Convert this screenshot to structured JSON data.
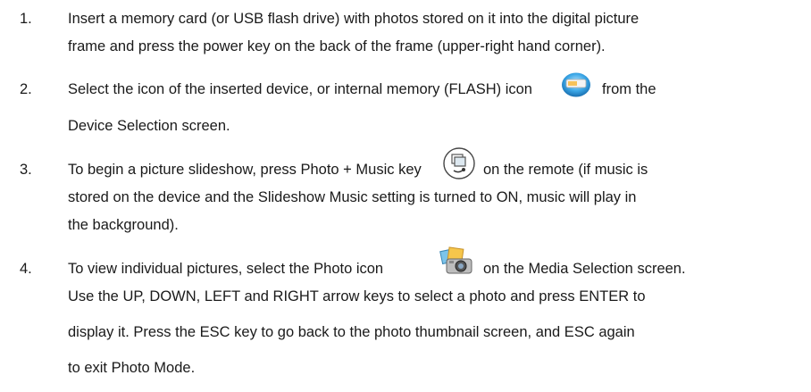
{
  "steps": [
    {
      "number": "1.",
      "lines": [
        "Insert a memory card (or USB flash drive) with photos stored on it into the digital picture",
        "frame and press the power key on the back of the frame (upper-right hand corner)."
      ]
    },
    {
      "number": "2.",
      "line1_before_icon": "Select the icon of the inserted device, or internal memory (FLASH) icon",
      "line1_after_icon": "from the",
      "line2": "Device Selection screen.",
      "icon": "flash-memory-icon"
    },
    {
      "number": "3.",
      "line1_before_icon": "To begin a picture slideshow, press Photo + Music key",
      "line1_after_icon": "on the remote (if music is",
      "line2": "stored on the device and the Slideshow Music setting is turned to ON, music will play in",
      "line3": "the background).",
      "icon": "photo-music-key-icon"
    },
    {
      "number": "4.",
      "line1_before_icon": "To view individual pictures, select the Photo icon",
      "line1_after_icon": "on the Media Selection screen.",
      "line2": "Use the UP, DOWN, LEFT and RIGHT arrow keys to select a photo and press ENTER to",
      "line3": "display it.   Press the ESC key to go back to the photo thumbnail screen, and ESC again",
      "line4": "to exit Photo Mode.",
      "icon": "photo-camera-icon"
    }
  ]
}
